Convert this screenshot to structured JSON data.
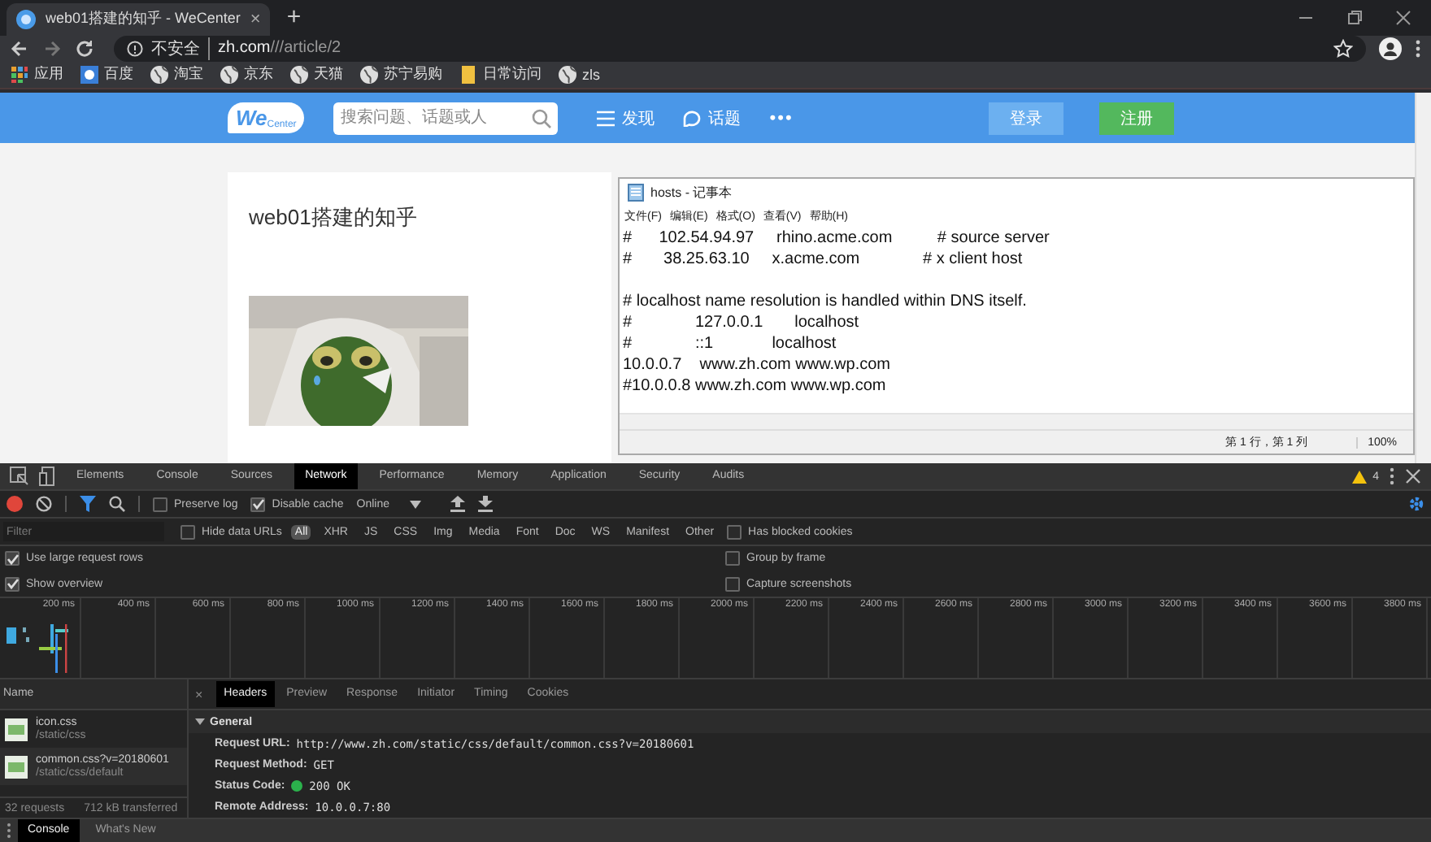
{
  "browser": {
    "tab": {
      "title": "web01搭建的知乎 - WeCenter",
      "close": "×"
    },
    "new_tab": "+",
    "address": {
      "security": "不安全",
      "host": "zh.com",
      "path": "///article/2"
    },
    "bookmarks": [
      {
        "label": "应用",
        "kind": "apps"
      },
      {
        "label": "百度",
        "kind": "site"
      },
      {
        "label": "淘宝",
        "kind": "globe"
      },
      {
        "label": "京东",
        "kind": "globe"
      },
      {
        "label": "天猫",
        "kind": "globe"
      },
      {
        "label": "苏宁易购",
        "kind": "globe"
      },
      {
        "label": "日常访问",
        "kind": "folder"
      },
      {
        "label": "zls",
        "kind": "globe"
      }
    ]
  },
  "page": {
    "logo": {
      "main": "We",
      "sub": "Center"
    },
    "search": {
      "placeholder": "搜索问题、话题或人"
    },
    "nav": [
      {
        "label": "发现",
        "kind": "list"
      },
      {
        "label": "话题",
        "kind": "chat"
      }
    ],
    "more": "•••",
    "login": "登录",
    "register": "注册",
    "article_title": "web01搭建的知乎"
  },
  "notepad": {
    "title": "hosts - 记事本",
    "menu": [
      "文件(F)",
      "编辑(E)",
      "格式(O)",
      "查看(V)",
      "帮助(H)"
    ],
    "lines": [
      {
        "kind": "text",
        "text": "#      102.54.94.97     rhino.acme.com          # source server"
      },
      {
        "kind": "text",
        "text": "#       38.25.63.10     x.acme.com              # x client host"
      },
      {
        "kind": "blank"
      },
      {
        "kind": "text",
        "text": "# localhost name resolution is handled within DNS itself."
      },
      {
        "kind": "text",
        "text": "#              127.0.0.1       localhost"
      },
      {
        "kind": "text",
        "text": "#              ::1             localhost"
      },
      {
        "kind": "text",
        "text": "10.0.0.7    www.zh.com www.wp.com"
      },
      {
        "kind": "text",
        "text": "#10.0.0.8 www.zh.com www.wp.com"
      }
    ],
    "status": [
      "第 1 行，第 1 列",
      "100%"
    ]
  },
  "devtools": {
    "tabs": [
      {
        "label": "Elements",
        "selected": false
      },
      {
        "label": "Console",
        "selected": false
      },
      {
        "label": "Sources",
        "selected": false
      },
      {
        "label": "Network",
        "selected": true
      },
      {
        "label": "Performance",
        "selected": false
      },
      {
        "label": "Memory",
        "selected": false
      },
      {
        "label": "Application",
        "selected": false
      },
      {
        "label": "Security",
        "selected": false
      },
      {
        "label": "Audits",
        "selected": false
      }
    ],
    "warnings": "4",
    "toolbar": {
      "recording": true,
      "preserve_log": {
        "label": "Preserve log",
        "checked": false
      },
      "disable_cache": {
        "label": "Disable cache",
        "checked": true
      },
      "throttle": "Online"
    },
    "filter": {
      "placeholder": "Filter",
      "hide_data_urls": {
        "label": "Hide data URLs",
        "checked": false
      },
      "types": [
        {
          "label": "All",
          "selected": true
        },
        {
          "label": "XHR",
          "selected": false
        },
        {
          "label": "JS",
          "selected": false
        },
        {
          "label": "CSS",
          "selected": false
        },
        {
          "label": "Img",
          "selected": false
        },
        {
          "label": "Media",
          "selected": false
        },
        {
          "label": "Font",
          "selected": false
        },
        {
          "label": "Doc",
          "selected": false
        },
        {
          "label": "WS",
          "selected": false
        },
        {
          "label": "Manifest",
          "selected": false
        },
        {
          "label": "Other",
          "selected": false
        }
      ],
      "has_blocked_cookies": {
        "label": "Has blocked cookies",
        "checked": false
      }
    },
    "options": [
      {
        "label": "Use large request rows",
        "checked": true
      },
      {
        "label": "Group by frame",
        "checked": false
      },
      {
        "label": "Show overview",
        "checked": true
      },
      {
        "label": "Capture screenshots",
        "checked": false
      }
    ],
    "timeline_ticks": [
      "200 ms",
      "400 ms",
      "600 ms",
      "800 ms",
      "1000 ms",
      "1200 ms",
      "1400 ms",
      "1600 ms",
      "1800 ms",
      "2000 ms",
      "2200 ms",
      "2400 ms",
      "2600 ms",
      "2800 ms",
      "3000 ms",
      "3200 ms",
      "3400 ms",
      "3600 ms",
      "3800 ms"
    ],
    "name_header": "Name",
    "requests": [
      {
        "name": "icon.css",
        "path": "/static/css"
      },
      {
        "name": "common.css?v=20180601",
        "path": "/static/css/default"
      }
    ],
    "summary": [
      "32 requests",
      "712 kB transferred"
    ],
    "detail_close": "×",
    "detail_tabs": [
      {
        "label": "Headers",
        "selected": true
      },
      {
        "label": "Preview",
        "selected": false
      },
      {
        "label": "Response",
        "selected": false
      },
      {
        "label": "Initiator",
        "selected": false
      },
      {
        "label": "Timing",
        "selected": false
      },
      {
        "label": "Cookies",
        "selected": false
      }
    ],
    "general": {
      "title": "General",
      "expanded": true,
      "fields": [
        {
          "label": "Request URL:",
          "value": "http://www.zh.com/static/css/default/common.css?v=20180601"
        },
        {
          "label": "Request Method:",
          "value": "GET"
        },
        {
          "label": "Status Code:",
          "value": "200 OK",
          "color": "#2bb24c"
        },
        {
          "label": "Remote Address:",
          "value": "10.0.0.7:80"
        }
      ]
    },
    "drawer_tabs": [
      {
        "label": "Console",
        "selected": true
      },
      {
        "label": "What's New",
        "selected": false
      }
    ]
  }
}
